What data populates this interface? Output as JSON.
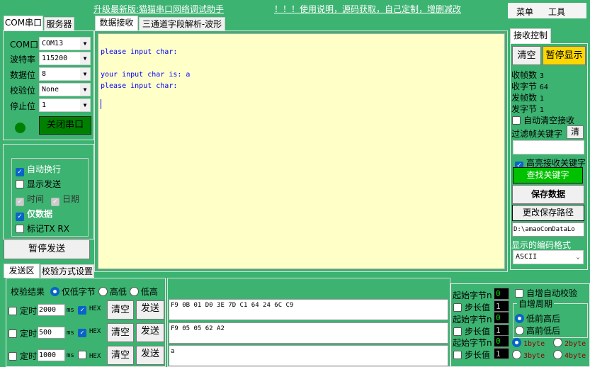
{
  "header": {
    "upgrade_link": "升级最新版:猫猫串口网络调试助手",
    "help_link": "！！！使用说明，源码获取，自己定制，增删减改",
    "menu": "菜单",
    "tools": "工具"
  },
  "left_tabs": [
    "COM串口",
    "服务器"
  ],
  "serial": {
    "fields": [
      {
        "label": "COM口",
        "value": "COM13"
      },
      {
        "label": "波特率",
        "value": "115200"
      },
      {
        "label": "数据位",
        "value": "8"
      },
      {
        "label": "校验位",
        "value": "None"
      },
      {
        "label": "停止位",
        "value": "1"
      }
    ],
    "close_button": "关闭串口",
    "led_color": "#008000"
  },
  "options": {
    "auto_wrap": "自动换行",
    "show_send": "显示发送",
    "time": "时间",
    "date": "日期",
    "data_only": "仅数据",
    "mark_txrx": "标记TX RX",
    "auto_wrap_checked": true,
    "show_send_checked": false,
    "time_checked": true,
    "date_checked": true,
    "data_only_checked": true,
    "mark_checked": false
  },
  "pause_send": "暂停发送",
  "recv_tabs": [
    "数据接收",
    "三通道字段解析-波形"
  ],
  "recv_lines": [
    "please input char:",
    "",
    "your input char is: a",
    "please input char:"
  ],
  "recv_control": {
    "tab": "接收控制",
    "clear": "清空",
    "pause_display": "暂停显示",
    "rx_frames_label": "收帧数",
    "rx_frames": "3",
    "rx_bytes_label": "收字节",
    "rx_bytes": "64",
    "tx_frames_label": "发帧数",
    "tx_frames": "1",
    "tx_bytes_label": "发字节",
    "tx_bytes": "1",
    "auto_clear": "自动清空接收",
    "filter_label": "过滤帧关键字",
    "filter_clear": "清",
    "highlight": "高亮接收关键字",
    "find": "查找关键字",
    "save": "保存数据",
    "change_path": "更改保存路径",
    "path": "D:\\amaoComDataLo",
    "encoding_label": "显示的编码格式",
    "encoding": "ASCII"
  },
  "send_tabs": [
    "发送区",
    "校验方式设置"
  ],
  "checksum": {
    "label": "校验结果",
    "options": [
      "仅低字节",
      "高低",
      "低高"
    ],
    "selected": 0
  },
  "send_rows": [
    {
      "timer_label": "定时",
      "interval": "2000",
      "unit": "ms",
      "hex": true,
      "hex_label": "HEX",
      "clear": "清空",
      "send": "发送",
      "content": "F9 0B 01 D0 3E 7D C1 64 24 6C C9"
    },
    {
      "timer_label": "定时",
      "interval": "500",
      "unit": "ms",
      "hex": true,
      "hex_label": "HEX",
      "clear": "清空",
      "send": "发送",
      "content": "F9 05 05 62 A2"
    },
    {
      "timer_label": "定时",
      "interval": "1000",
      "unit": "ms",
      "hex": false,
      "hex_label": "HEX",
      "clear": "清空",
      "send": "发送",
      "content": "a"
    }
  ],
  "auto_inc": {
    "start_label": "起始字节n",
    "step_label": "步长值",
    "rows": [
      {
        "start": "0",
        "step": "1"
      },
      {
        "start": "0",
        "step": "1"
      },
      {
        "start": "0",
        "step": "1"
      }
    ],
    "auto_check": "自增自动校验",
    "period": "自增周期",
    "low_first": "低前高后",
    "high_first": "高前低后",
    "byte_opts": [
      "1byte",
      "2byte",
      "3byte",
      "4byte"
    ]
  }
}
